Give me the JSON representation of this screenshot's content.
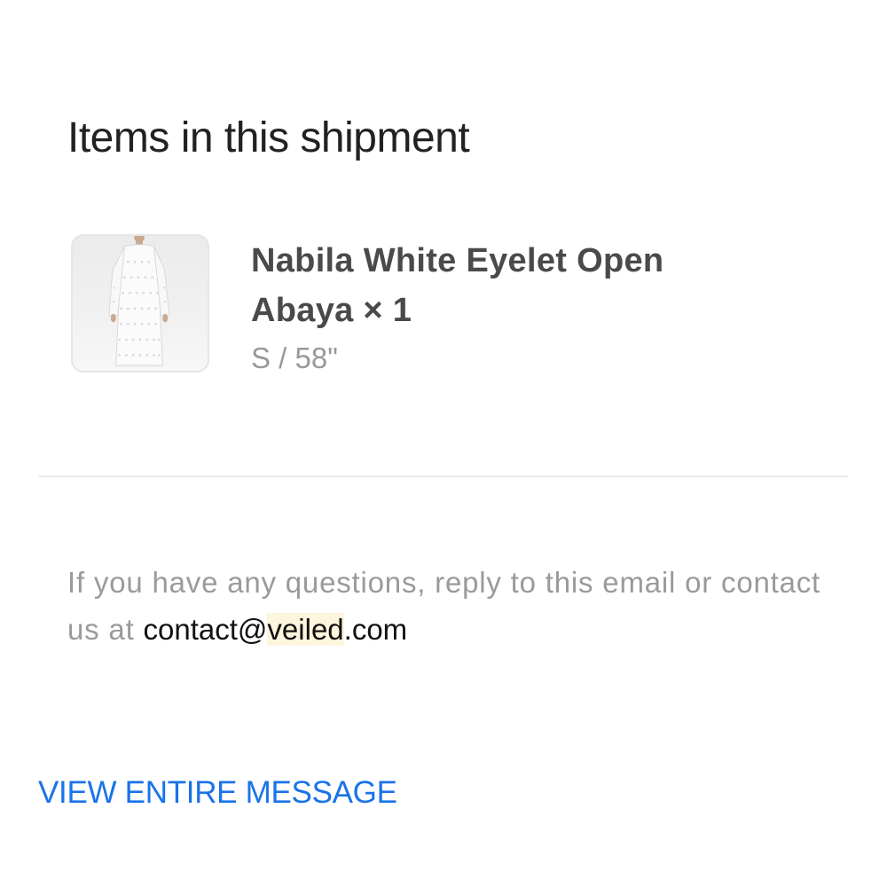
{
  "section": {
    "title": "Items in this shipment"
  },
  "item": {
    "name": "Nabila White Eyelet Open Abaya × 1",
    "variant": "S / 58\""
  },
  "footer_note": {
    "text": "If you have any questions, reply to this email or contact us at ",
    "email_prefix": "contact@",
    "email_highlight": "veiled",
    "email_suffix": ".com"
  },
  "view_entire_message": "VIEW ENTIRE MESSAGE",
  "colors": {
    "link": "#1a73e8",
    "highlight": "#fdf5dc"
  }
}
